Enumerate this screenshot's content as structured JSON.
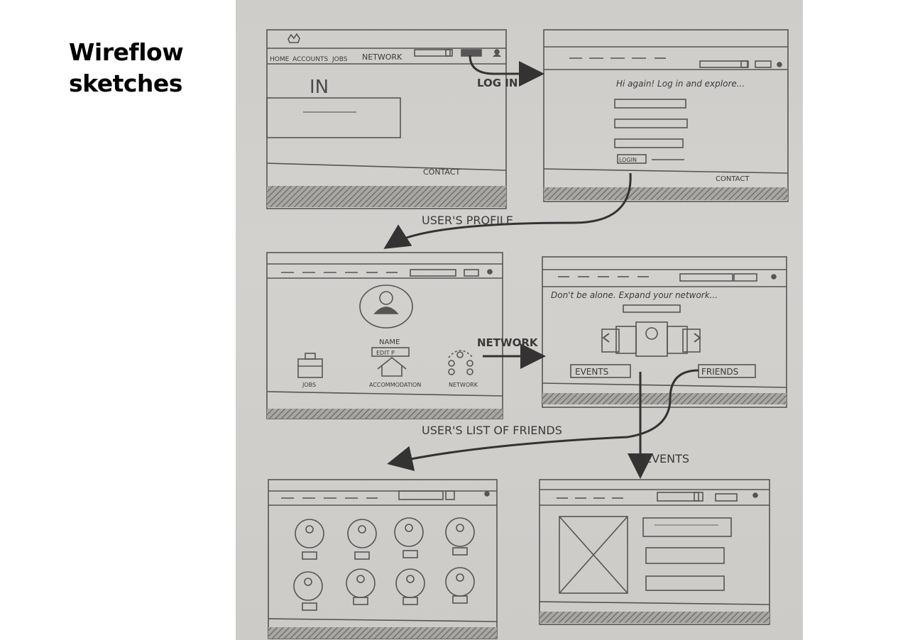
{
  "title": {
    "line1": "Wireflow",
    "line2": "sketches"
  },
  "screens": {
    "home": {
      "nav": [
        "HOME",
        "ACCOUNTS",
        "JOBS",
        "NETWORK"
      ],
      "logo": "IN",
      "footer": "CONTACT"
    },
    "login": {
      "greeting": "Hi again! Log in and explore...",
      "button": "LOGIN",
      "footer": "CONTACT"
    },
    "profile": {
      "name": "NAME",
      "edit": "EDIT P",
      "jobs": "JOBS",
      "accommodation": "ACCOMMODATION",
      "network": "NETWORK"
    },
    "network": {
      "tagline": "Don't be alone. Expand your network...",
      "events": "EVENTS",
      "friends": "FRIENDS"
    }
  },
  "flow_labels": {
    "login": "LOG IN",
    "profile": "USER'S PROFILE",
    "network": "NETWORK",
    "friends": "USER'S LIST OF FRIENDS",
    "events": "EVENTS"
  }
}
